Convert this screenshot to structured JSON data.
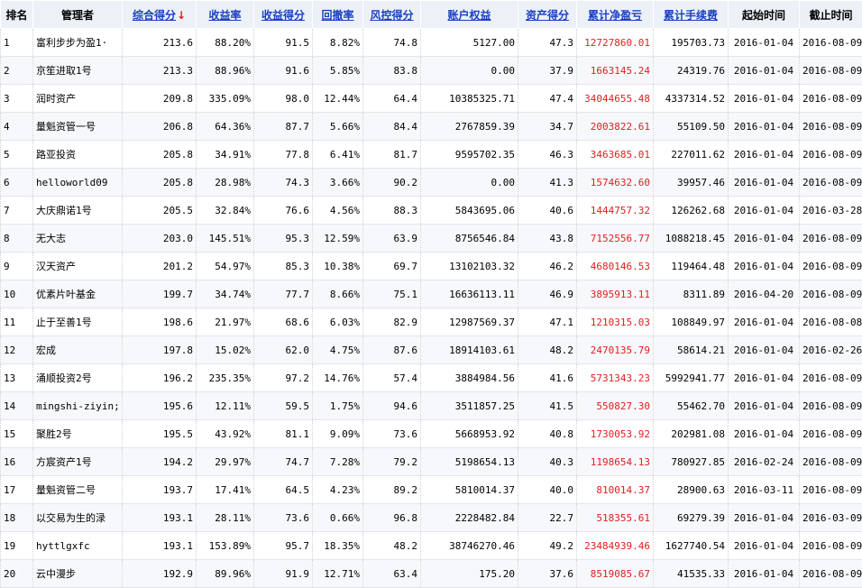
{
  "colors": {
    "header_bg": "#ecf1f8",
    "link": "#1a3fc0",
    "sort_arrow": "#e02020",
    "net_profit": "#e02020",
    "row_alt": "#f6f8fc"
  },
  "headers": {
    "rank": "排名",
    "manager": "管理者",
    "composite_score": "综合得分",
    "sort_arrow": "↓",
    "return_rate": "收益率",
    "return_score": "收益得分",
    "drawdown": "回撤率",
    "risk_score": "风控得分",
    "equity": "账户权益",
    "asset_score": "资产得分",
    "net_profit": "累计净盈亏",
    "fees": "累计手续费",
    "start_date": "起始时间",
    "end_date": "截止时间"
  },
  "rows": [
    {
      "rank": "1",
      "manager": "富利步步为盈1·",
      "composite": "213.6",
      "return_rate": "88.20%",
      "return_score": "91.5",
      "drawdown": "8.82%",
      "risk_score": "74.8",
      "equity": "5127.00",
      "asset_score": "47.3",
      "net_profit": "12727860.01",
      "fees": "195703.73",
      "start": "2016-01-04",
      "end": "2016-08-09"
    },
    {
      "rank": "2",
      "manager": "京笙进取1号",
      "composite": "213.3",
      "return_rate": "88.96%",
      "return_score": "91.6",
      "drawdown": "5.85%",
      "risk_score": "83.8",
      "equity": "0.00",
      "asset_score": "37.9",
      "net_profit": "1663145.24",
      "fees": "24319.76",
      "start": "2016-01-04",
      "end": "2016-08-09"
    },
    {
      "rank": "3",
      "manager": "润时资产",
      "composite": "209.8",
      "return_rate": "335.09%",
      "return_score": "98.0",
      "drawdown": "12.44%",
      "risk_score": "64.4",
      "equity": "10385325.71",
      "asset_score": "47.4",
      "net_profit": "34044655.48",
      "fees": "4337314.52",
      "start": "2016-01-04",
      "end": "2016-08-09"
    },
    {
      "rank": "4",
      "manager": "量魁资管一号",
      "composite": "206.8",
      "return_rate": "64.36%",
      "return_score": "87.7",
      "drawdown": "5.66%",
      "risk_score": "84.4",
      "equity": "2767859.39",
      "asset_score": "34.7",
      "net_profit": "2003822.61",
      "fees": "55109.50",
      "start": "2016-01-04",
      "end": "2016-08-09"
    },
    {
      "rank": "5",
      "manager": "路亚投资",
      "composite": "205.8",
      "return_rate": "34.91%",
      "return_score": "77.8",
      "drawdown": "6.41%",
      "risk_score": "81.7",
      "equity": "9595702.35",
      "asset_score": "46.3",
      "net_profit": "3463685.01",
      "fees": "227011.62",
      "start": "2016-01-04",
      "end": "2016-08-09"
    },
    {
      "rank": "6",
      "manager": "helloworld09",
      "composite": "205.8",
      "return_rate": "28.98%",
      "return_score": "74.3",
      "drawdown": "3.66%",
      "risk_score": "90.2",
      "equity": "0.00",
      "asset_score": "41.3",
      "net_profit": "1574632.60",
      "fees": "39957.46",
      "start": "2016-01-04",
      "end": "2016-08-09"
    },
    {
      "rank": "7",
      "manager": "大庆鼎诺1号",
      "composite": "205.5",
      "return_rate": "32.84%",
      "return_score": "76.6",
      "drawdown": "4.56%",
      "risk_score": "88.3",
      "equity": "5843695.06",
      "asset_score": "40.6",
      "net_profit": "1444757.32",
      "fees": "126262.68",
      "start": "2016-01-04",
      "end": "2016-03-28"
    },
    {
      "rank": "8",
      "manager": "无大志",
      "composite": "203.0",
      "return_rate": "145.51%",
      "return_score": "95.3",
      "drawdown": "12.59%",
      "risk_score": "63.9",
      "equity": "8756546.84",
      "asset_score": "43.8",
      "net_profit": "7152556.77",
      "fees": "1088218.45",
      "start": "2016-01-04",
      "end": "2016-08-09"
    },
    {
      "rank": "9",
      "manager": "汉天资产",
      "composite": "201.2",
      "return_rate": "54.97%",
      "return_score": "85.3",
      "drawdown": "10.38%",
      "risk_score": "69.7",
      "equity": "13102103.32",
      "asset_score": "46.2",
      "net_profit": "4680146.53",
      "fees": "119464.48",
      "start": "2016-01-04",
      "end": "2016-08-09"
    },
    {
      "rank": "10",
      "manager": "优素片叶基金",
      "composite": "199.7",
      "return_rate": "34.74%",
      "return_score": "77.7",
      "drawdown": "8.66%",
      "risk_score": "75.1",
      "equity": "16636113.11",
      "asset_score": "46.9",
      "net_profit": "3895913.11",
      "fees": "8311.89",
      "start": "2016-04-20",
      "end": "2016-08-09"
    },
    {
      "rank": "11",
      "manager": "止于至善1号",
      "composite": "198.6",
      "return_rate": "21.97%",
      "return_score": "68.6",
      "drawdown": "6.03%",
      "risk_score": "82.9",
      "equity": "12987569.37",
      "asset_score": "47.1",
      "net_profit": "1210315.03",
      "fees": "108849.97",
      "start": "2016-01-04",
      "end": "2016-08-08"
    },
    {
      "rank": "12",
      "manager": "宏成",
      "composite": "197.8",
      "return_rate": "15.02%",
      "return_score": "62.0",
      "drawdown": "4.75%",
      "risk_score": "87.6",
      "equity": "18914103.61",
      "asset_score": "48.2",
      "net_profit": "2470135.79",
      "fees": "58614.21",
      "start": "2016-01-04",
      "end": "2016-02-26"
    },
    {
      "rank": "13",
      "manager": "涌顺投资2号",
      "composite": "196.2",
      "return_rate": "235.35%",
      "return_score": "97.2",
      "drawdown": "14.76%",
      "risk_score": "57.4",
      "equity": "3884984.56",
      "asset_score": "41.6",
      "net_profit": "5731343.23",
      "fees": "5992941.77",
      "start": "2016-01-04",
      "end": "2016-08-09"
    },
    {
      "rank": "14",
      "manager": "mingshi-ziyin;",
      "composite": "195.6",
      "return_rate": "12.11%",
      "return_score": "59.5",
      "drawdown": "1.75%",
      "risk_score": "94.6",
      "equity": "3511857.25",
      "asset_score": "41.5",
      "net_profit": "550827.30",
      "fees": "55462.70",
      "start": "2016-01-04",
      "end": "2016-08-09"
    },
    {
      "rank": "15",
      "manager": "聚胜2号",
      "composite": "195.5",
      "return_rate": "43.92%",
      "return_score": "81.1",
      "drawdown": "9.09%",
      "risk_score": "73.6",
      "equity": "5668953.92",
      "asset_score": "40.8",
      "net_profit": "1730053.92",
      "fees": "202981.08",
      "start": "2016-01-04",
      "end": "2016-08-09"
    },
    {
      "rank": "16",
      "manager": "方宸资产1号",
      "composite": "194.2",
      "return_rate": "29.97%",
      "return_score": "74.7",
      "drawdown": "7.28%",
      "risk_score": "79.2",
      "equity": "5198654.13",
      "asset_score": "40.3",
      "net_profit": "1198654.13",
      "fees": "780927.85",
      "start": "2016-02-24",
      "end": "2016-08-09"
    },
    {
      "rank": "17",
      "manager": "量魁资管二号",
      "composite": "193.7",
      "return_rate": "17.41%",
      "return_score": "64.5",
      "drawdown": "4.23%",
      "risk_score": "89.2",
      "equity": "5810014.37",
      "asset_score": "40.0",
      "net_profit": "810014.37",
      "fees": "28900.63",
      "start": "2016-03-11",
      "end": "2016-08-09"
    },
    {
      "rank": "18",
      "manager": "以交易为生的渌",
      "composite": "193.1",
      "return_rate": "28.11%",
      "return_score": "73.6",
      "drawdown": "0.66%",
      "risk_score": "96.8",
      "equity": "2228482.84",
      "asset_score": "22.7",
      "net_profit": "518355.61",
      "fees": "69279.39",
      "start": "2016-01-04",
      "end": "2016-03-09"
    },
    {
      "rank": "19",
      "manager": "hyttlgxfc",
      "composite": "193.1",
      "return_rate": "153.89%",
      "return_score": "95.7",
      "drawdown": "18.35%",
      "risk_score": "48.2",
      "equity": "38746270.46",
      "asset_score": "49.2",
      "net_profit": "23484939.46",
      "fees": "1627740.54",
      "start": "2016-01-04",
      "end": "2016-08-09"
    },
    {
      "rank": "20",
      "manager": "云中漫步",
      "composite": "192.9",
      "return_rate": "89.96%",
      "return_score": "91.9",
      "drawdown": "12.71%",
      "risk_score": "63.4",
      "equity": "175.20",
      "asset_score": "37.6",
      "net_profit": "8519085.67",
      "fees": "41535.33",
      "start": "2016-01-04",
      "end": "2016-08-09"
    }
  ]
}
